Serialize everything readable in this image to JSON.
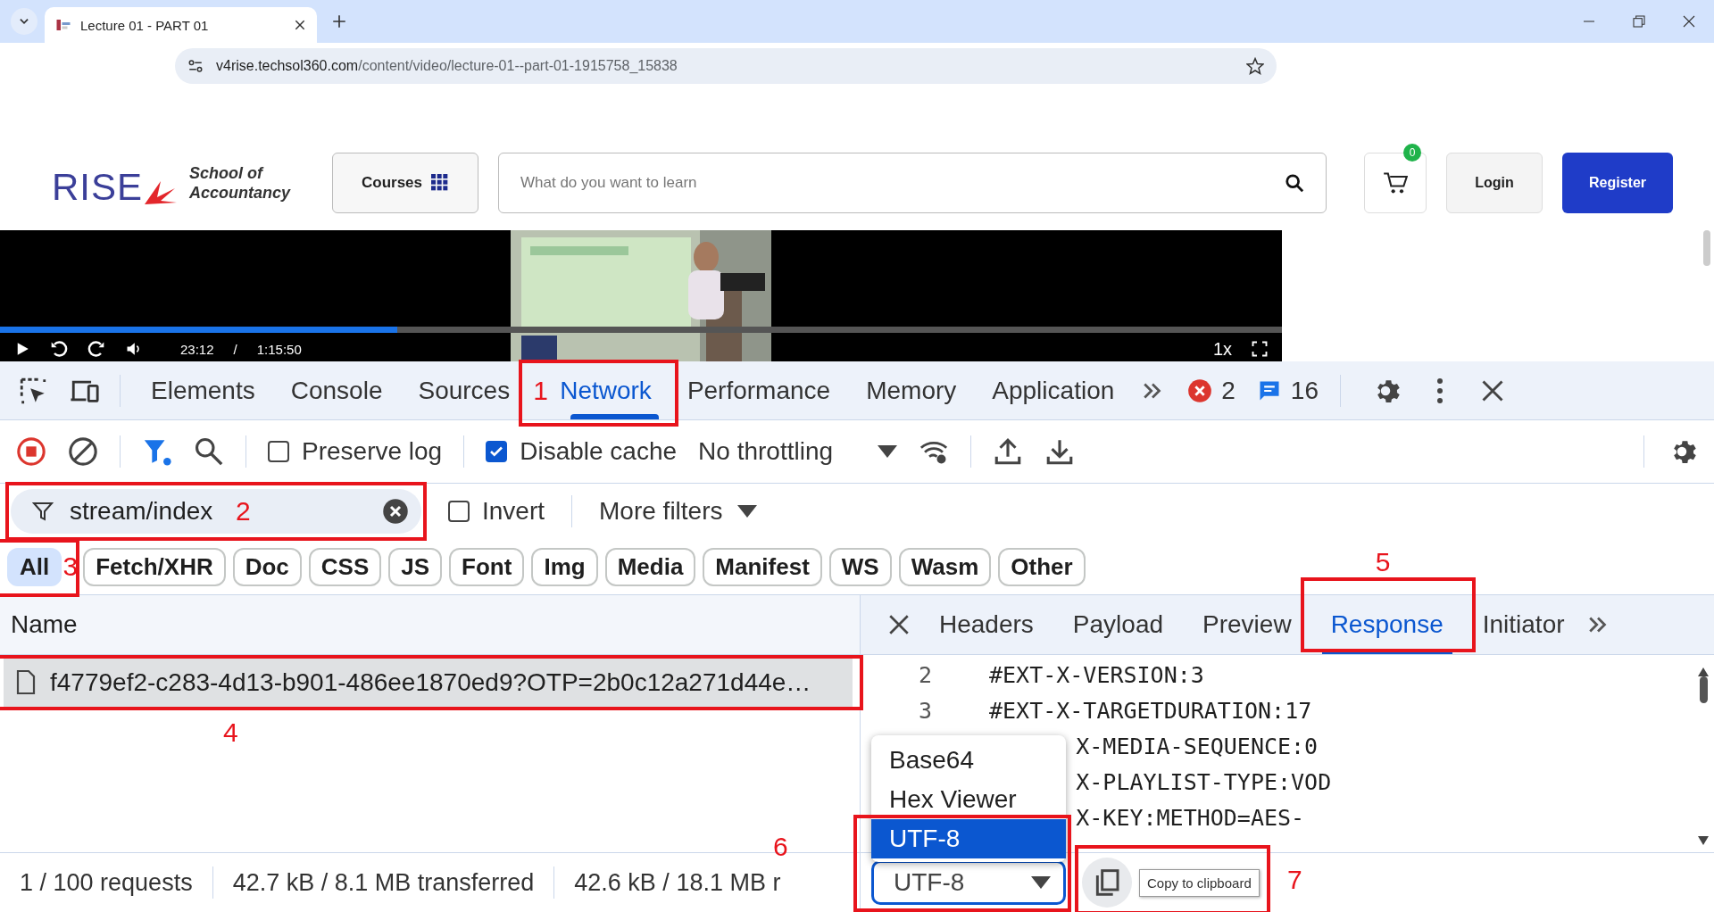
{
  "browser": {
    "tab_title": "Lecture 01 - PART 01",
    "url_host": "v4rise.techsol360.com",
    "url_path": "/content/video/lecture-01--part-01-1915758_15838"
  },
  "site": {
    "logo_text": "RISE",
    "tagline": [
      "School of",
      "Accountancy"
    ],
    "courses_button": "Courses",
    "search_placeholder": "What do you want to learn",
    "cart_count": "0",
    "login": "Login",
    "register": "Register"
  },
  "video": {
    "elapsed": "23:12",
    "separator": "/",
    "duration": "1:15:50",
    "speed": "1x",
    "level": 0.31
  },
  "devtools": {
    "tabs": [
      {
        "label": "Elements",
        "selected": false
      },
      {
        "label": "Console",
        "selected": false
      },
      {
        "label": "Sources",
        "selected": false
      },
      {
        "label": "Network",
        "selected": true,
        "annotation": {
          "number": "1"
        }
      },
      {
        "label": "Performance",
        "selected": false
      },
      {
        "label": "Memory",
        "selected": false
      },
      {
        "label": "Application",
        "selected": false
      }
    ],
    "error_count": "2",
    "message_count": "16",
    "preserve_log": {
      "label": "Preserve log",
      "checked": false
    },
    "disable_cache": {
      "label": "Disable cache",
      "checked": true
    },
    "throttling": "No throttling",
    "filter": {
      "value": "stream/index",
      "annotation": {
        "number": "2"
      }
    },
    "invert": {
      "label": "Invert",
      "checked": false
    },
    "more_filters": "More filters",
    "type_filters": [
      {
        "label": "All",
        "selected": true,
        "annotation": {
          "number": "3"
        }
      },
      {
        "label": "Fetch/XHR",
        "selected": false
      },
      {
        "label": "Doc",
        "selected": false
      },
      {
        "label": "CSS",
        "selected": false
      },
      {
        "label": "JS",
        "selected": false
      },
      {
        "label": "Font",
        "selected": false
      },
      {
        "label": "Img",
        "selected": false
      },
      {
        "label": "Media",
        "selected": false
      },
      {
        "label": "Manifest",
        "selected": false
      },
      {
        "label": "WS",
        "selected": false
      },
      {
        "label": "Wasm",
        "selected": false
      },
      {
        "label": "Other",
        "selected": false
      }
    ],
    "requests": {
      "column": "Name",
      "rows": [
        {
          "name": "f4779ef2-c283-4d13-b901-486ee1870ed9?OTP=2b0c12a271d44e…",
          "selected": true,
          "annotation": {
            "number": "4"
          }
        }
      ]
    },
    "status": [
      "1 / 100 requests",
      "42.7 kB / 8.1 MB transferred",
      "42.6 kB / 18.1 MB r"
    ],
    "detail_tabs": [
      {
        "label": "Headers",
        "selected": false
      },
      {
        "label": "Payload",
        "selected": false
      },
      {
        "label": "Preview",
        "selected": false
      },
      {
        "label": "Response",
        "selected": true,
        "annotation": {
          "number": "5"
        }
      },
      {
        "label": "Initiator",
        "selected": false
      }
    ],
    "response_lines": [
      {
        "number": "2",
        "text": "#EXT-X-VERSION:3"
      },
      {
        "number": "3",
        "text": "#EXT-X-TARGETDURATION:17"
      },
      {
        "text": "X-MEDIA-SEQUENCE:0"
      },
      {
        "text": "X-PLAYLIST-TYPE:VOD"
      },
      {
        "text": "X-KEY:METHOD=AES-"
      }
    ],
    "encoding": {
      "options": [
        {
          "label": "Base64",
          "selected": false
        },
        {
          "label": "Hex Viewer",
          "selected": false
        },
        {
          "label": "UTF-8",
          "selected": true
        }
      ],
      "value": "UTF-8",
      "annotation": {
        "number": "6"
      }
    },
    "copy": {
      "tooltip": "Copy to clipboard",
      "annotation": {
        "number": "7"
      }
    }
  }
}
